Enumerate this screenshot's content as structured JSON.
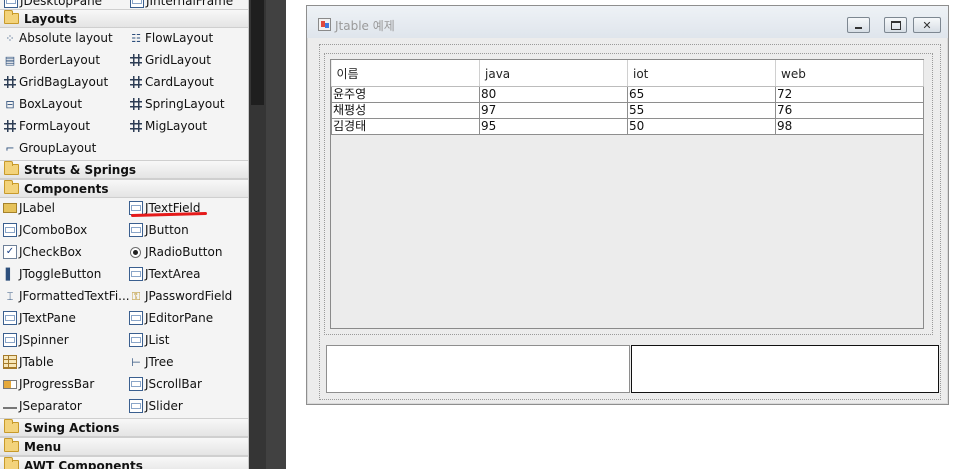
{
  "palette": {
    "top_partial_items": [
      "JDesktopPane",
      "JInternalFrame"
    ],
    "categories": {
      "layouts": "Layouts",
      "struts": "Struts & Springs",
      "components": "Components",
      "swing_actions": "Swing Actions",
      "menu": "Menu",
      "awt": "AWT Components"
    },
    "layouts": [
      {
        "label": "Absolute layout",
        "icon": "absolute-layout-icon"
      },
      {
        "label": "FlowLayout",
        "icon": "flow-layout-icon"
      },
      {
        "label": "BorderLayout",
        "icon": "border-layout-icon"
      },
      {
        "label": "GridLayout",
        "icon": "grid-layout-icon"
      },
      {
        "label": "GridBagLayout",
        "icon": "gridbag-layout-icon"
      },
      {
        "label": "CardLayout",
        "icon": "card-layout-icon"
      },
      {
        "label": "BoxLayout",
        "icon": "box-layout-icon"
      },
      {
        "label": "SpringLayout",
        "icon": "spring-layout-icon"
      },
      {
        "label": "FormLayout",
        "icon": "form-layout-icon"
      },
      {
        "label": "MigLayout",
        "icon": "mig-layout-icon"
      },
      {
        "label": "GroupLayout",
        "icon": "group-layout-icon"
      }
    ],
    "components": [
      {
        "label": "JLabel",
        "icon": "jlabel-icon"
      },
      {
        "label": "JTextField",
        "icon": "jtextfield-icon"
      },
      {
        "label": "JComboBox",
        "icon": "jcombobox-icon"
      },
      {
        "label": "JButton",
        "icon": "jbutton-icon"
      },
      {
        "label": "JCheckBox",
        "icon": "jcheckbox-icon"
      },
      {
        "label": "JRadioButton",
        "icon": "jradiobutton-icon"
      },
      {
        "label": "JToggleButton",
        "icon": "jtogglebutton-icon"
      },
      {
        "label": "JTextArea",
        "icon": "jtextarea-icon"
      },
      {
        "label": "JFormattedTextFi...",
        "icon": "jformattedtextfield-icon"
      },
      {
        "label": "JPasswordField",
        "icon": "jpasswordfield-icon"
      },
      {
        "label": "JTextPane",
        "icon": "jtextpane-icon"
      },
      {
        "label": "JEditorPane",
        "icon": "jeditorpane-icon"
      },
      {
        "label": "JSpinner",
        "icon": "jspinner-icon"
      },
      {
        "label": "JList",
        "icon": "jlist-icon"
      },
      {
        "label": "JTable",
        "icon": "jtable-icon"
      },
      {
        "label": "JTree",
        "icon": "jtree-icon"
      },
      {
        "label": "JProgressBar",
        "icon": "jprogressbar-icon"
      },
      {
        "label": "JScrollBar",
        "icon": "jscrollbar-icon"
      },
      {
        "label": "JSeparator",
        "icon": "jseparator-icon"
      },
      {
        "label": "JSlider",
        "icon": "jslider-icon"
      }
    ]
  },
  "frame": {
    "title": "Jtable 예제",
    "table": {
      "columns": [
        "이름",
        "java",
        "iot",
        "web"
      ],
      "rows": [
        [
          "윤주영",
          "80",
          "65",
          "72"
        ],
        [
          "채평성",
          "97",
          "55",
          "76"
        ],
        [
          "김경태",
          "95",
          "50",
          "98"
        ]
      ]
    },
    "text_fields": [
      "",
      ""
    ]
  },
  "colors": {
    "annotation_underline": "#e51a1a",
    "palette_bg": "#f4f4f4",
    "dark_panel": "#414141"
  }
}
